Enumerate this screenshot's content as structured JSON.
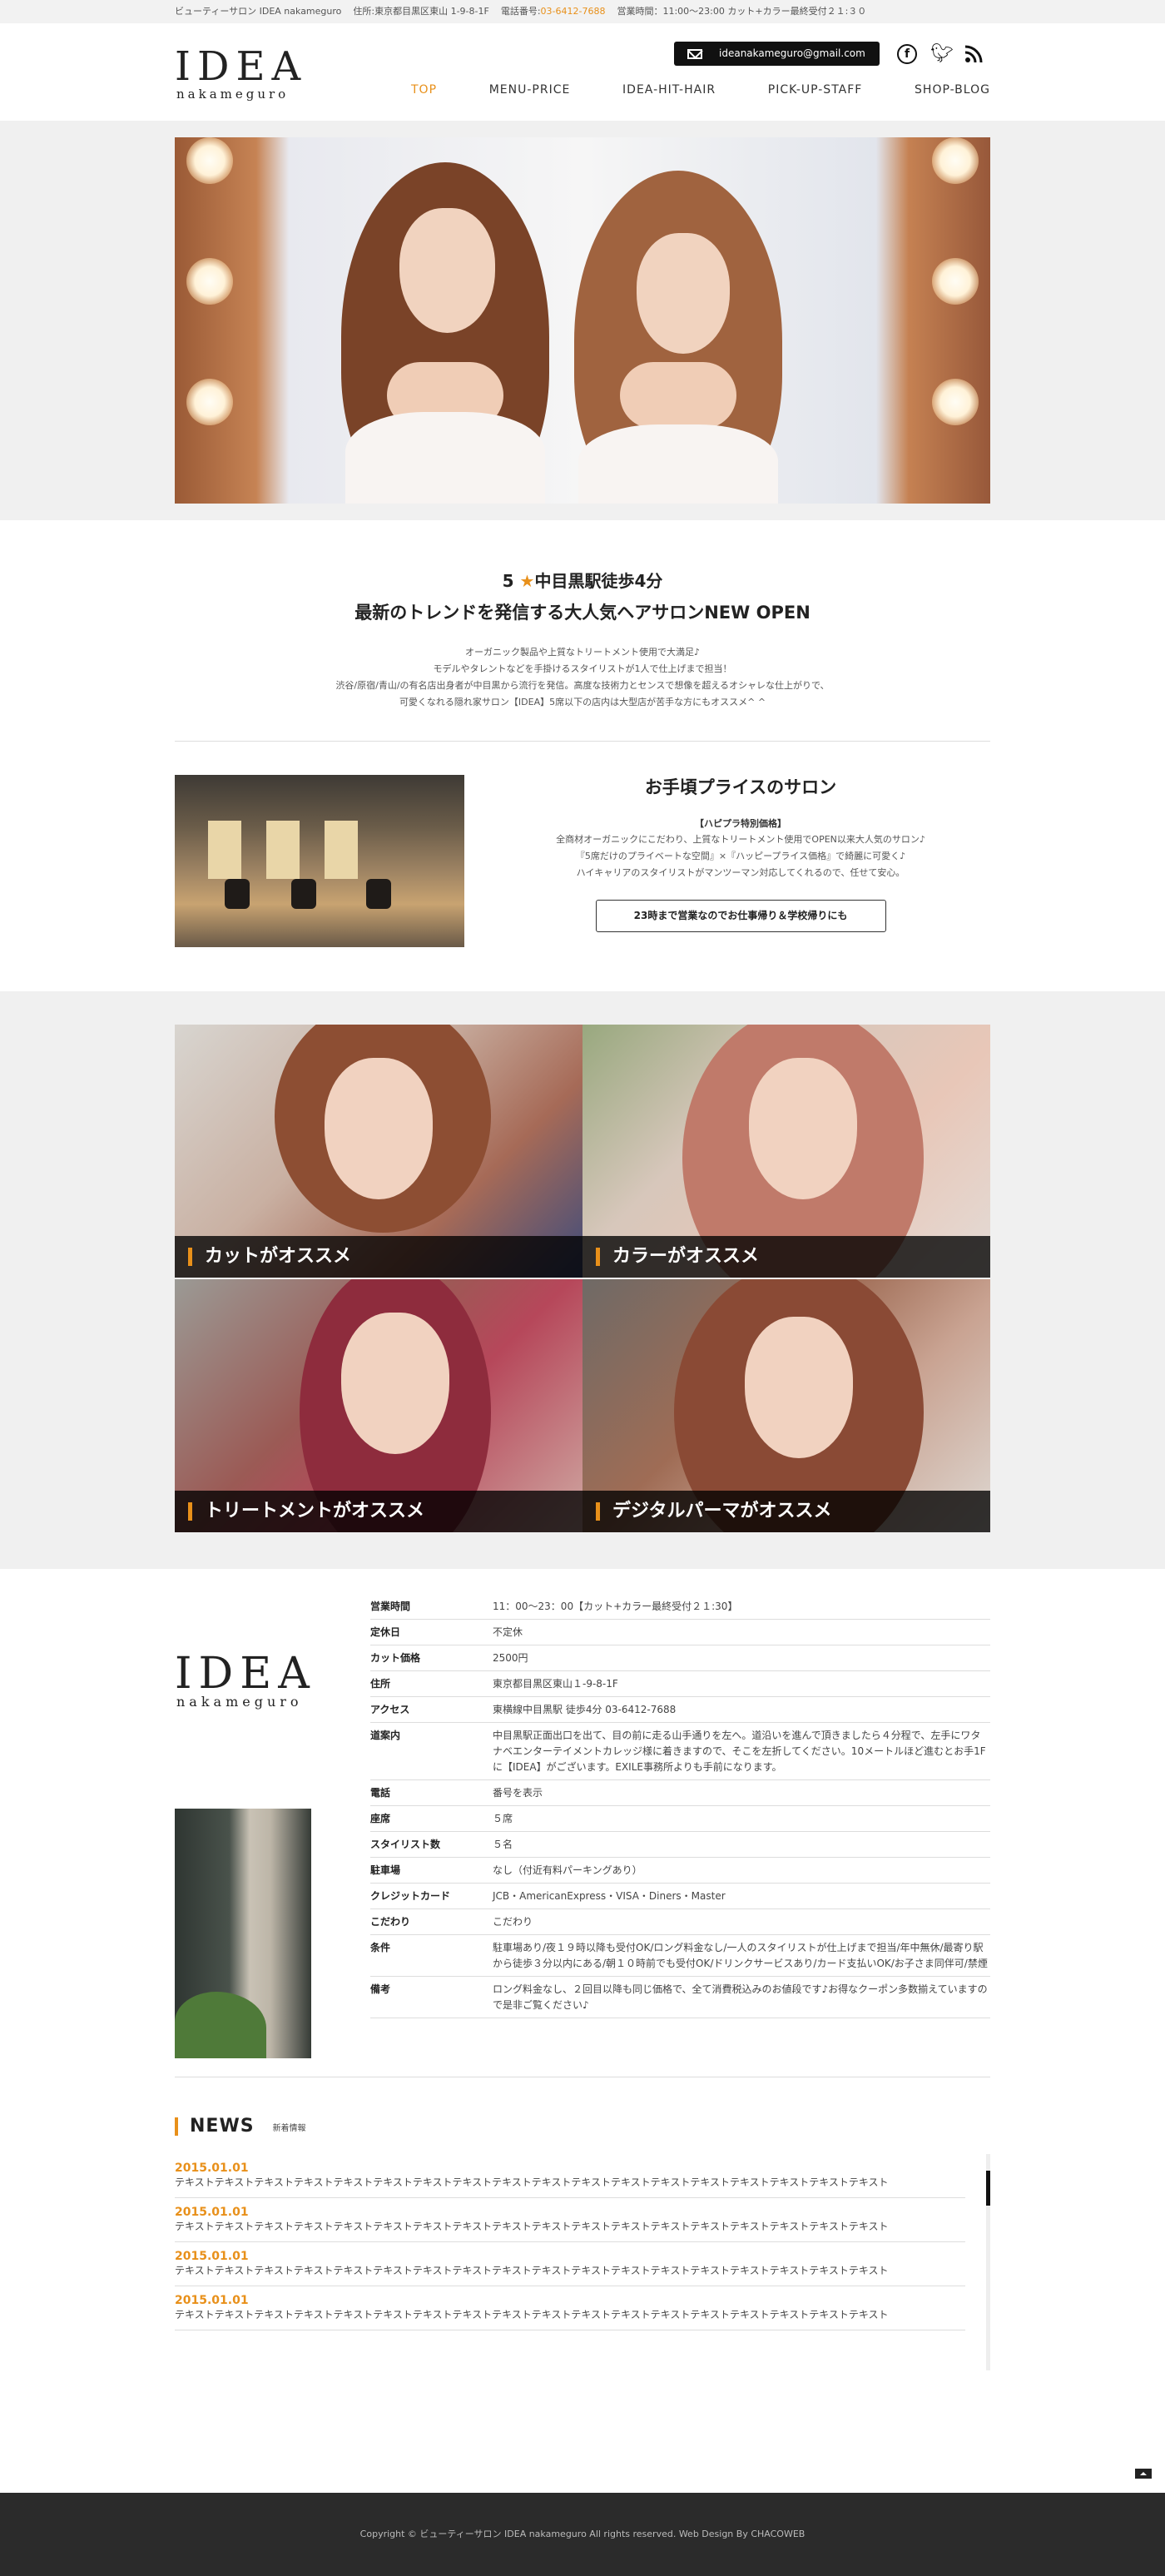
{
  "topbar": {
    "name": "ビューティーサロン IDEA nakameguro",
    "address": "住所:東京都目黒区東山 1-9-8-1F",
    "phone_label": "電話番号:",
    "phone": "03-6412-7688",
    "hours": "営業時間：11:00～23:00  カット+カラー最終受付２１:３０"
  },
  "header": {
    "logo_main": "IDEA",
    "logo_sub": "nakameguro",
    "email": "ideanakameguro@gmail.com",
    "facebook_icon": "facebook-icon",
    "twitter_icon": "twitter-icon",
    "rss_icon": "rss-icon",
    "nav": [
      "TOP",
      "MENU-PRICE",
      "IDEA-HIT-HAIR",
      "PICK-UP-STAFF",
      "SHOP-BLOG"
    ],
    "nav_active": "TOP"
  },
  "intro": {
    "line1_prefix": "5",
    "star": "★",
    "line1_suffix": "中目黒駅徒歩4分",
    "line2": "最新のトレンドを発信する大人気ヘアサロンNEW OPEN",
    "p1": "オーガニック製品や上質なトリートメント使用で大満足♪",
    "p2": "モデルやタレントなどを手掛けるスタイリストが1人で仕上げまで担当！",
    "p3": "渋谷/原宿/青山/の有名店出身者が中目黒から流行を発信。高度な技術力とセンスで想像を超えるオシャレな仕上がりで、",
    "p4": "可愛くなれる隠れ家サロン【IDEA】5席以下の店内は大型店が苦手な方にもオススメ^ ^"
  },
  "salon": {
    "title": "お手頃プライスのサロン",
    "sub": "【ハピプラ特別価格】",
    "p1": "全商材オーガニックにこだわり、上質なトリートメント使用でOPEN以来大人気のサロン♪",
    "p2": "『5席だけのプライベートな空間』×『ハッピープライス価格』で綺麗に可愛く♪",
    "p3": "ハイキャリアのスタイリストがマンツーマン対応してくれるので、任せて安心。",
    "button": "23時まで営業なのでお仕事帰り＆学校帰りにも"
  },
  "recommend": [
    {
      "label": "カットがオススメ"
    },
    {
      "label": "カラーがオススメ"
    },
    {
      "label": "トリートメントがオススメ"
    },
    {
      "label": "デジタルパーマがオススメ"
    }
  ],
  "info": {
    "logo_main": "IDEA",
    "logo_sub": "nakameguro",
    "rows": [
      {
        "k": "営業時間",
        "v": "11：00～23：00【カット+カラー最終受付２１:30】"
      },
      {
        "k": "定休日",
        "v": "不定休"
      },
      {
        "k": "カット価格",
        "v": "2500円"
      },
      {
        "k": "住所",
        "v": "東京都目黒区東山１-9-8-1F"
      },
      {
        "k": "アクセス",
        "v": "東横線中目黒駅 徒歩4分  03-6412-7688"
      },
      {
        "k": "道案内",
        "v": "中目黒駅正面出口を出て、目の前に走る山手通りを左へ。道沿いを進んで頂きましたら４分程で、左手にワタナベエンターテイメントカレッジ様に着きますので、そこを左折してください。10メートルほど進むとお手1Fに【IDEA】がございます。EXILE事務所よりも手前になります。"
      },
      {
        "k": "電話",
        "v": "番号を表示"
      },
      {
        "k": "座席",
        "v": "５席"
      },
      {
        "k": "スタイリスト数",
        "v": "５名"
      },
      {
        "k": "駐車場",
        "v": "なし（付近有料パーキングあり）"
      },
      {
        "k": "クレジットカード",
        "v": "JCB・AmericanExpress・VISA・Diners・Master"
      },
      {
        "k": "こだわり",
        "v": "こだわり"
      },
      {
        "k": "条件",
        "v": "駐車場あり/夜１９時以降も受付OK/ロング料金なし/一人のスタイリストが仕上げまで担当/年中無休/最寄り駅から徒歩３分以内にある/朝１０時前でも受付OK/ドリンクサービスあり/カード支払いOK/お子さま同伴可/禁煙"
      },
      {
        "k": "備考",
        "v": "ロング料金なし、２回目以降も同じ価格で、全て消費税込みのお値段です♪お得なクーポン多数揃えていますので是非ご覧ください♪"
      }
    ]
  },
  "news": {
    "title": "NEWS",
    "sub": "新着情報",
    "items": [
      {
        "date": "2015.01.01",
        "text": "テキストテキストテキストテキストテキストテキストテキストテキストテキストテキストテキストテキストテキストテキストテキストテキストテキストテキスト"
      },
      {
        "date": "2015.01.01",
        "text": "テキストテキストテキストテキストテキストテキストテキストテキストテキストテキストテキストテキストテキストテキストテキストテキストテキストテキスト"
      },
      {
        "date": "2015.01.01",
        "text": "テキストテキストテキストテキストテキストテキストテキストテキストテキストテキストテキストテキストテキストテキストテキストテキストテキストテキスト"
      },
      {
        "date": "2015.01.01",
        "text": "テキストテキストテキストテキストテキストテキストテキストテキストテキストテキストテキストテキストテキストテキストテキストテキストテキストテキスト"
      }
    ]
  },
  "footer": {
    "copyright": "Copyright © ビューティーサロン IDEA nakameguro All rights reserved. Web Design By CHACOWEB"
  },
  "colors": {
    "accent": "#e8901a",
    "footer_bg": "#2b2b2b",
    "band_bg": "#f0f0f0"
  }
}
